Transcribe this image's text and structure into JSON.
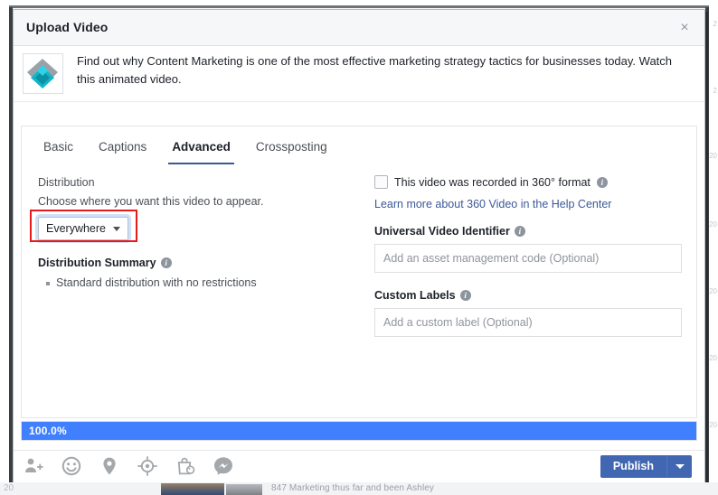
{
  "dialog": {
    "title": "Upload Video",
    "close_label": "×"
  },
  "video_info": {
    "description": "Find out why Content Marketing is one of the most effective marketing strategy tactics for businesses today. Watch this animated video."
  },
  "tabs": [
    {
      "label": "Basic",
      "active": false
    },
    {
      "label": "Captions",
      "active": false
    },
    {
      "label": "Advanced",
      "active": true
    },
    {
      "label": "Crossposting",
      "active": false
    }
  ],
  "advanced": {
    "distribution": {
      "title": "Distribution",
      "subtitle": "Choose where you want this video to appear.",
      "selected": "Everywhere"
    },
    "distribution_summary": {
      "title": "Distribution Summary",
      "info": "i",
      "items": [
        "Standard distribution with no restrictions"
      ]
    },
    "video_360": {
      "checkbox_label": "This video was recorded in 360° format",
      "info": "i",
      "checked": false,
      "help_link": "Learn more about 360 Video in the Help Center"
    },
    "universal_video_identifier": {
      "label": "Universal Video Identifier",
      "info": "i",
      "value": "",
      "placeholder": "Add an asset management code (Optional)"
    },
    "custom_labels": {
      "label": "Custom Labels",
      "info": "i",
      "value": "",
      "placeholder": "Add a custom label (Optional)"
    }
  },
  "progress": {
    "percent_label": "100.0%",
    "percent_value": 100
  },
  "footer": {
    "icons": [
      {
        "name": "tag-person-icon"
      },
      {
        "name": "emoji-smiley-icon"
      },
      {
        "name": "location-pin-icon"
      },
      {
        "name": "target-crosshair-icon"
      },
      {
        "name": "shopping-bag-icon"
      },
      {
        "name": "messenger-icon"
      }
    ],
    "publish_label": "Publish",
    "publish_dropdown": "▾"
  },
  "annotation": {
    "color": "#e8191b",
    "target": "distribution-dropdown"
  },
  "background": {
    "bottom_text": "847 Marketing thus far and been Ashley",
    "bottom_left_text": "20"
  }
}
